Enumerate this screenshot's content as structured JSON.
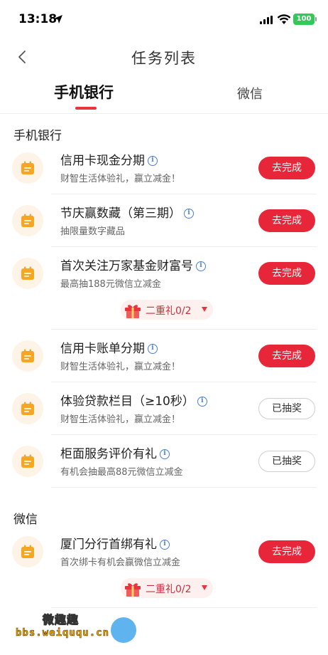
{
  "status_bar": {
    "time": "13:18",
    "battery": "100"
  },
  "nav": {
    "title": "任务列表"
  },
  "tabs": [
    {
      "label": "手机银行",
      "active": true
    },
    {
      "label": "微信",
      "active": false
    }
  ],
  "sections": [
    {
      "title": "手机银行",
      "tasks": [
        {
          "title": "信用卡现金分期",
          "subtitle": "财智生活体验礼，赢立减金！",
          "button": "去完成",
          "status": "pending"
        },
        {
          "title": "节庆赢数藏（第三期）",
          "subtitle": "抽限量数字藏品",
          "button": "去完成",
          "status": "pending"
        },
        {
          "title": "首次关注万家基金财富号",
          "subtitle": "最高抽188元微信立减金",
          "button": "去完成",
          "status": "pending",
          "gift": "二重礼0/2"
        },
        {
          "title": "信用卡账单分期",
          "subtitle": "财智生活体验礼，赢立减金！",
          "button": "去完成",
          "status": "pending"
        },
        {
          "title": "体验贷款栏目（≥10秒）",
          "subtitle": "财智生活体验礼，赢立减金！",
          "button": "已抽奖",
          "status": "drawn"
        },
        {
          "title": "柜面服务评价有礼",
          "subtitle": "有机会抽最高88元微信立减金",
          "button": "已抽奖",
          "status": "drawn"
        }
      ]
    },
    {
      "title": "微信",
      "tasks": [
        {
          "title": "厦门分行首绑有礼",
          "subtitle": "首次绑卡有机会赢微信立减金",
          "button": "去完成",
          "status": "pending",
          "gift": "二重礼0/2"
        }
      ]
    }
  ],
  "watermark": {
    "line1": "微趣趣",
    "line2": "bbs.weiququ.cn"
  },
  "colors": {
    "accent": "#e8263a",
    "icon_orange": "#f5a623",
    "info_blue": "#4a7fd0"
  },
  "icons": {
    "task": "calendar-icon",
    "info": "info-icon",
    "gift": "gift-icon",
    "back": "back-chevron-icon"
  }
}
